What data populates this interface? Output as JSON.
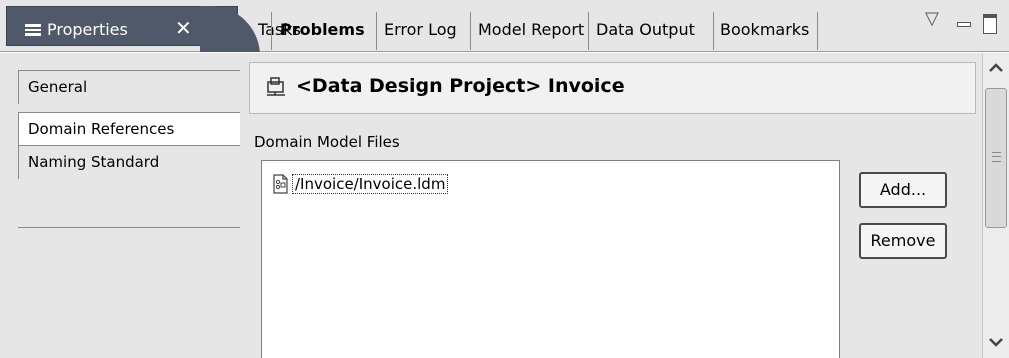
{
  "tabs": {
    "active": {
      "label": "Properties",
      "close": "✕"
    },
    "items": [
      {
        "label": "Tasks"
      },
      {
        "label": "Problems"
      },
      {
        "label": "Error Log"
      },
      {
        "label": "Model Report"
      },
      {
        "label": "Data Output"
      },
      {
        "label": "Bookmarks"
      }
    ],
    "view_menu": "▽"
  },
  "sidebar": {
    "items": [
      {
        "label": "General"
      },
      {
        "label": "Domain References"
      },
      {
        "label": "Naming Standard"
      }
    ]
  },
  "header": {
    "title": "<Data Design Project> Invoice"
  },
  "domain_section": {
    "label": "Domain Model Files",
    "files": [
      {
        "name": "/Invoice/Invoice.ldm"
      }
    ],
    "add_button": "Add...",
    "remove_button": "Remove"
  },
  "colors": {
    "active_tab": "#4f5969",
    "panel_background": "#e6e6e6"
  }
}
